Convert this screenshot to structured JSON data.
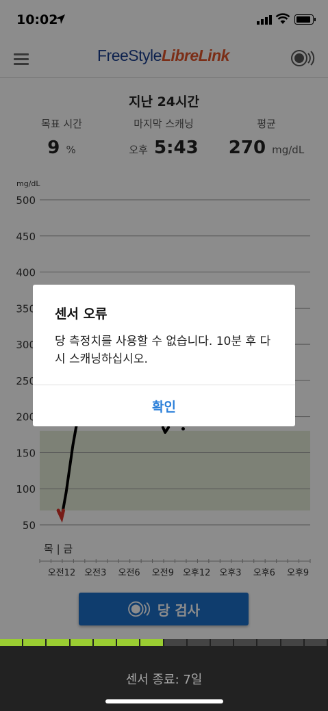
{
  "status": {
    "time": "10:02"
  },
  "app": {
    "logo_part1": "FreeStyle",
    "logo_part2": "LibreLink"
  },
  "summary": {
    "period": "지난 24시간",
    "target_label": "목표 시간",
    "target_value": "9",
    "target_unit": "%",
    "last_scan_label": "마지막 스캐닝",
    "last_scan_ampm": "오후",
    "last_scan_time": "5:43",
    "avg_label": "평균",
    "avg_value": "270",
    "avg_unit": "mg/dL"
  },
  "chart_data": {
    "type": "line",
    "ylabel": "mg/dL",
    "y_ticks": [
      "500",
      "450",
      "400",
      "350",
      "300",
      "250",
      "200",
      "150",
      "100",
      "50"
    ],
    "ylim": [
      50,
      500
    ],
    "target_range": [
      70,
      180
    ],
    "day_labels": "목 | 금",
    "x_ticks": [
      "오전12",
      "오전3",
      "오전6",
      "오전9",
      "오후12",
      "오후3",
      "오후6",
      "오후9"
    ],
    "series": [
      {
        "values": [
          {
            "x": -0.3,
            "y": 70
          },
          {
            "x": 0.0,
            "y": 60
          },
          {
            "x": 0.4,
            "y": 95
          },
          {
            "x": 1.0,
            "y": 160
          },
          {
            "x": 1.4,
            "y": 195
          },
          {
            "x": 9.0,
            "y": 185
          },
          {
            "x": 9.2,
            "y": 178
          },
          {
            "x": 9.5,
            "y": 185
          },
          {
            "x": 10.8,
            "y": 183
          }
        ]
      }
    ],
    "low_color": "#d9342b",
    "line_color": "#000000",
    "range_color": "#e4ecd8"
  },
  "actions": {
    "check_glucose": "당 검사"
  },
  "sensor": {
    "footer_text": "센서 종료: 7일",
    "segments": [
      "#9acd32",
      "#9acd32",
      "#9acd32",
      "#9acd32",
      "#9acd32",
      "#9acd32",
      "#9acd32",
      "#444",
      "#444",
      "#444",
      "#444",
      "#444",
      "#444",
      "#444"
    ]
  },
  "dialog": {
    "title": "센서 오류",
    "message": "당 측정치를 사용할 수 없습니다. 10분 후 다시 스캐닝하십시오.",
    "ok_label": "확인"
  }
}
